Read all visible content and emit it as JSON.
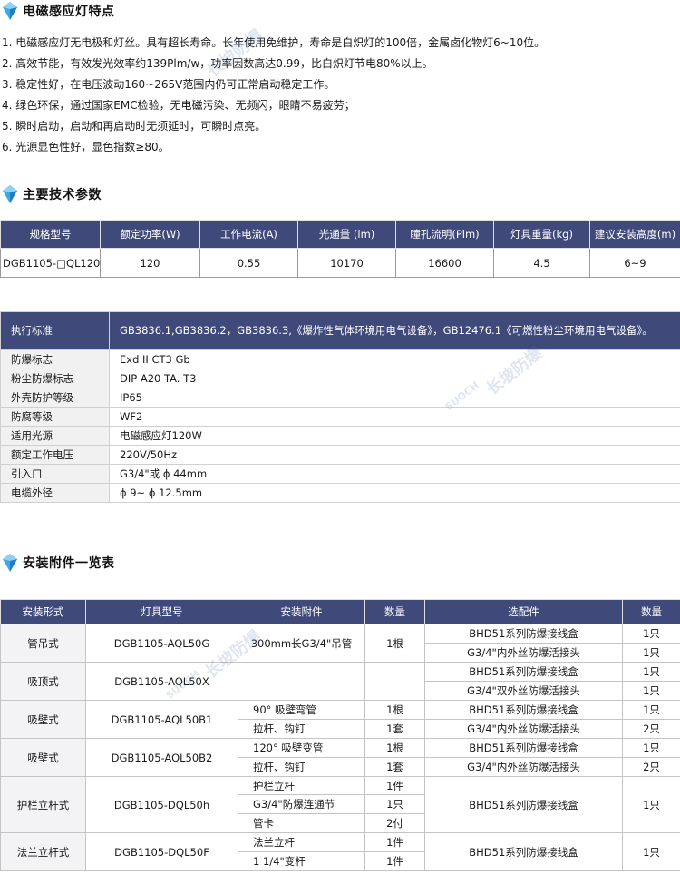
{
  "sections": {
    "features_title": "电磁感应灯特点",
    "specs_title": "主要技术参数",
    "accessories_title": "安装附件一览表"
  },
  "features": [
    "1. 电磁感应灯无电极和灯丝。具有超长寿命。长年使用免维护，寿命是白炽灯的100倍，金属卤化物灯6~10位。",
    "2. 高效节能，有效发光效率约139Plm/w，功率因数高达0.99，比白炽灯节电80%以上。",
    "3. 稳定性好，在电压波动160~265V范围内仍可正常启动稳定工作。",
    "4. 绿色环保，通过国家EMC检验，无电磁污染、无频闪，眼睛不易疲劳；",
    "5. 瞬时启动，启动和再启动时无须延时，可瞬时点亮。",
    "6. 光源显色性好，显色指数≥80。"
  ],
  "spec_table": {
    "headers": [
      "规格型号",
      "额定功率(W)",
      "工作电流(A)",
      "光通量 (lm)",
      "瞳孔流明(Plm)",
      "灯具重量(kg)",
      "建议安装高度(m)"
    ],
    "row": [
      "DGB1105-□QL120",
      "120",
      "0.55",
      "10170",
      "16600",
      "4.5",
      "6~9"
    ]
  },
  "param_table": {
    "header_label": "执行标准",
    "header_value": "GB3836.1,GB3836.2，GB3836.3,《爆炸性气体环境用电气设备》，GB12476.1《可燃性粉尘环境用电气设备》。",
    "rows": [
      {
        "label": "防爆标志",
        "value": "Exd II CT3  Gb"
      },
      {
        "label": "粉尘防爆标志",
        "value": "DIP A20 TA. T3"
      },
      {
        "label": "外壳防护等级",
        "value": "IP65"
      },
      {
        "label": "防腐等级",
        "value": "WF2"
      },
      {
        "label": "适用光源",
        "value": "电磁感应灯120W"
      },
      {
        "label": "额定工作电压",
        "value": "220V/50Hz"
      },
      {
        "label": "引入口",
        "value": "G3/4\"或 ϕ 44mm"
      },
      {
        "label": "电缆外径",
        "value": "ϕ 9~ ϕ 12.5mm"
      }
    ]
  },
  "accessory_table": {
    "headers": [
      "安装形式",
      "灯具型号",
      "安装附件",
      "数量",
      "选配件",
      "数量"
    ],
    "groups": [
      {
        "form": "管吊式",
        "model": "DGB1105-AQL50G",
        "fittings": [
          {
            "name": "300mm长G3/4\"吊管",
            "qty": "1根"
          }
        ],
        "options": [
          {
            "name": "BHD51系列防爆接线盒",
            "qty": "1只"
          },
          {
            "name": "G3/4\"内外丝防爆活接头",
            "qty": "1只"
          }
        ]
      },
      {
        "form": "吸顶式",
        "model": "DGB1105-AQL50X",
        "fittings": [],
        "options": [
          {
            "name": "BHD51系列防爆接线盒",
            "qty": "1只"
          },
          {
            "name": "G3/4\"双外丝防爆活接头",
            "qty": "1只"
          }
        ]
      },
      {
        "form": "吸壁式",
        "model": "DGB1105-AQL50B1",
        "fittings": [
          {
            "name": "90° 吸壁弯管",
            "qty": "1根"
          },
          {
            "name": "拉杆、钩钉",
            "qty": "1套"
          }
        ],
        "options": [
          {
            "name": "BHD51系列防爆接线盒",
            "qty": "1只"
          },
          {
            "name": "G3/4\"内外丝防爆活接头",
            "qty": "2只"
          }
        ]
      },
      {
        "form": "吸壁式",
        "model": "DGB1105-AQL50B2",
        "fittings": [
          {
            "name": "120° 吸壁变管",
            "qty": "1根"
          },
          {
            "name": "拉杆、钩钉",
            "qty": "1套"
          }
        ],
        "options": [
          {
            "name": "BHD51系列防爆接线盒",
            "qty": "1只"
          },
          {
            "name": "G3/4\"内外丝防爆活接头",
            "qty": "2只"
          }
        ]
      },
      {
        "form": "护栏立杆式",
        "model": "DGB1105-DQL50h",
        "fittings": [
          {
            "name": "护栏立杆",
            "qty": "1件"
          },
          {
            "name": "G3/4\"防爆连通节",
            "qty": "1只"
          },
          {
            "name": "管卡",
            "qty": "2付"
          }
        ],
        "options": [
          {
            "name": "BHD51系列防爆接线盒",
            "qty": "1只"
          }
        ]
      },
      {
        "form": "法兰立杆式",
        "model": "DGB1105-DQL50F",
        "fittings": [
          {
            "name": "法兰立杆",
            "qty": "1件"
          },
          {
            "name": "1 1/4\"变杆",
            "qty": "1件"
          }
        ],
        "options": [
          {
            "name": "BHD51系列防爆接线盒",
            "qty": "1只"
          }
        ]
      }
    ]
  },
  "colors": {
    "header_bg": "#3f4a7a",
    "gem_blue": "#3ea8e6"
  },
  "watermarks": [
    "长坡防爆",
    "SUOCH"
  ]
}
